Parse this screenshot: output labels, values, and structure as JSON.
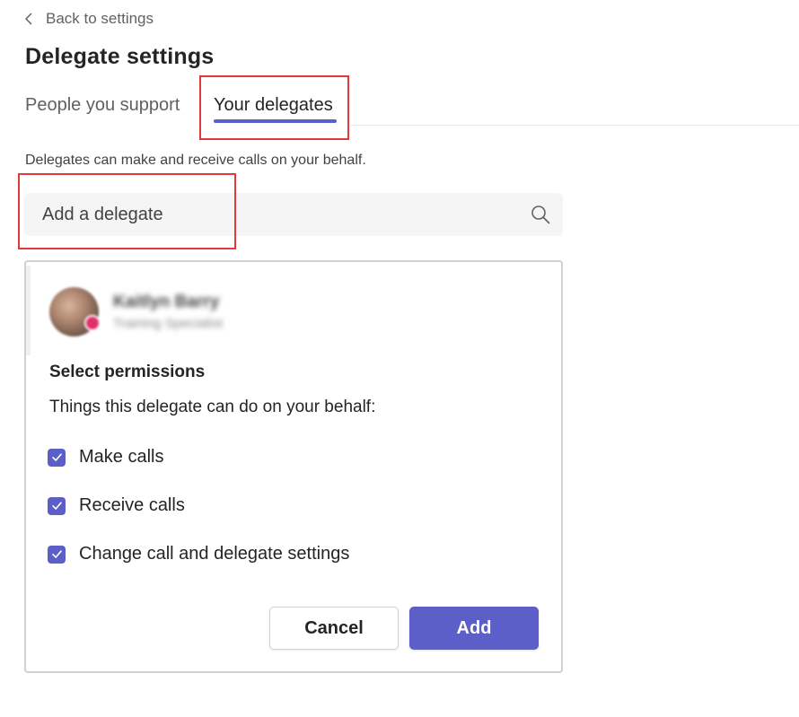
{
  "nav": {
    "back_label": "Back to settings"
  },
  "page": {
    "title": "Delegate settings"
  },
  "tabs": [
    {
      "label": "People you support",
      "selected": false
    },
    {
      "label": "Your delegates",
      "selected": true
    }
  ],
  "description": "Delegates can make and receive calls on your behalf.",
  "search": {
    "placeholder": "Add a delegate",
    "value": "",
    "icon": "search-icon"
  },
  "delegate_card": {
    "person": {
      "name": "Kaitlyn Barry",
      "role": "Training Specialist",
      "presence": "busy"
    },
    "permissions_title": "Select permissions",
    "permissions_description": "Things this delegate can do on your behalf:",
    "permissions": [
      {
        "label": "Make calls",
        "checked": true
      },
      {
        "label": "Receive calls",
        "checked": true
      },
      {
        "label": "Change call and delegate settings",
        "checked": true
      }
    ],
    "cancel_label": "Cancel",
    "add_label": "Add"
  },
  "colors": {
    "accent": "#5b5fc7",
    "highlight": "#e03b3b",
    "presence_busy": "#e0306b"
  }
}
